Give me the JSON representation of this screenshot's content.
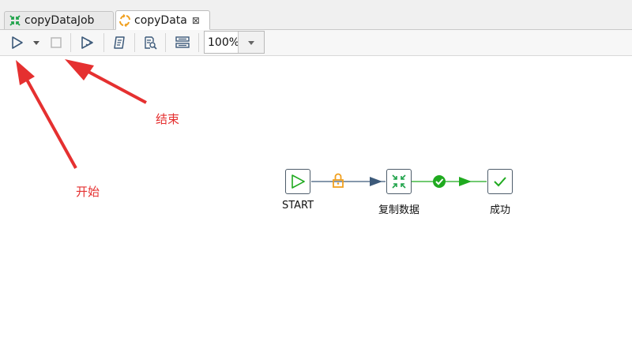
{
  "tabs": [
    {
      "label": "copyDataJob",
      "icon": "job-icon",
      "active": false
    },
    {
      "label": "copyData",
      "icon": "transformation-icon",
      "active": true,
      "close": "⊠"
    }
  ],
  "toolbar": {
    "zoom_value": "100%",
    "buttons": [
      "run-icon",
      "run-dropdown-icon",
      "stop-icon",
      "replay-icon",
      "check-icon",
      "sql-icon",
      "layout-icon"
    ]
  },
  "annotations": {
    "end_label": "结束",
    "start_label": "开始"
  },
  "flow": {
    "nodes": [
      {
        "id": "start",
        "label": "START",
        "icon": "start-icon"
      },
      {
        "id": "copy",
        "label": "复制数据",
        "icon": "transformation-icon"
      },
      {
        "id": "success",
        "label": "成功",
        "icon": "success-icon"
      }
    ],
    "hops": [
      {
        "from": "start",
        "to": "copy",
        "type": "unconditional",
        "color": "#f0a020"
      },
      {
        "from": "copy",
        "to": "success",
        "type": "on-success",
        "color": "#1faa1f"
      }
    ]
  },
  "colors": {
    "annotation": "#e53030",
    "hop_blue": "#3d5a7a",
    "success_green": "#1faa1f",
    "lock_orange": "#f0a020"
  }
}
